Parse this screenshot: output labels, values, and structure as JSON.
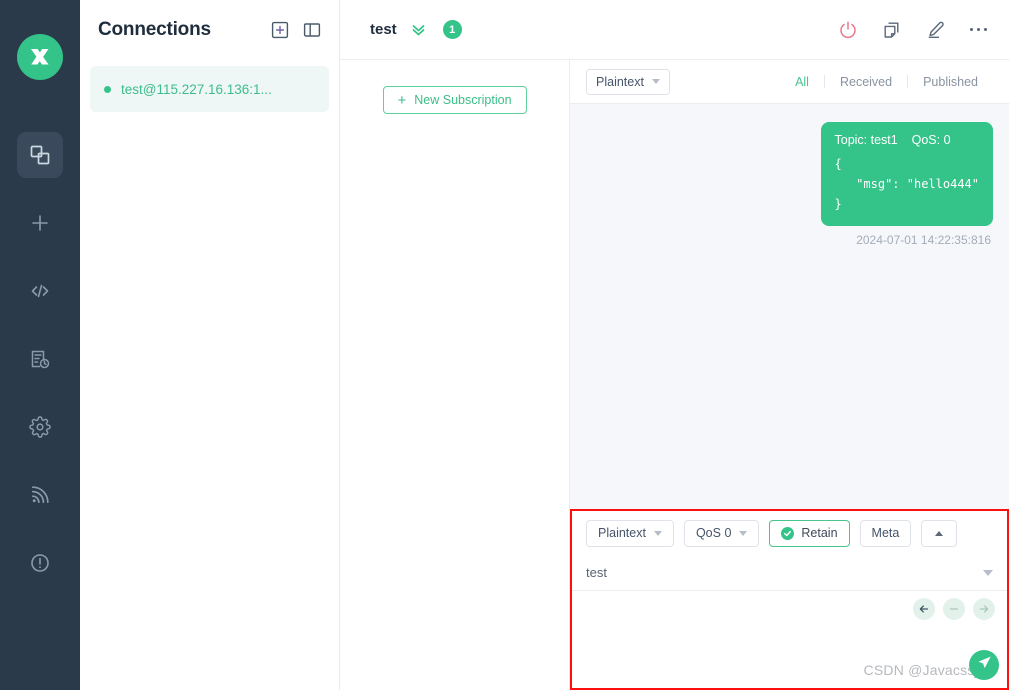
{
  "app": {
    "logo_icon": "mqttx-logo-icon",
    "accent_color": "#34c388",
    "rail_bg": "#2b3a4a",
    "highlight_border_color": "#fb0f0f"
  },
  "rail": {
    "items": [
      {
        "icon": "connections-icon",
        "name": "sidebar-item-connections",
        "active": true
      },
      {
        "icon": "plus-icon",
        "name": "sidebar-item-new-connection",
        "active": false
      },
      {
        "icon": "code-icon",
        "name": "sidebar-item-scripts",
        "active": false
      },
      {
        "icon": "log-history-icon",
        "name": "sidebar-item-log",
        "active": false
      },
      {
        "icon": "gear-icon",
        "name": "sidebar-item-settings",
        "active": false
      },
      {
        "icon": "broadcast-icon",
        "name": "sidebar-item-broadcast",
        "active": false
      },
      {
        "icon": "info-circle-icon",
        "name": "sidebar-item-about",
        "active": false
      }
    ]
  },
  "connections": {
    "title": "Connections",
    "new_icon": "plus-square-icon",
    "layout_icon": "panel-layout-icon",
    "items": [
      {
        "label": "test@115.227.16.136:1...",
        "status": "connected"
      }
    ]
  },
  "topbar": {
    "title": "test",
    "chevron_icon": "double-chevron-down-icon",
    "badge": "1",
    "actions": [
      {
        "name": "disconnect-button",
        "icon": "power-icon"
      },
      {
        "name": "copy-connection-button",
        "icon": "copy-icon"
      },
      {
        "name": "edit-connection-button",
        "icon": "pencil-icon"
      },
      {
        "name": "more-options-button",
        "icon": "ellipsis-icon"
      }
    ]
  },
  "subscriptions": {
    "new_subscription_label": "New Subscription",
    "plus_glyph": "+"
  },
  "messages": {
    "format_select": "Plaintext",
    "filters": [
      {
        "label": "All",
        "active": true
      },
      {
        "label": "Received",
        "active": false
      },
      {
        "label": "Published",
        "active": false
      }
    ],
    "list": [
      {
        "meta": "Topic: test1    QoS: 0",
        "body": "{\n   \"msg\": \"hello444\"\n}",
        "time": "2024-07-01 14:22:35:816",
        "direction": "published"
      }
    ]
  },
  "publish": {
    "format_select": "Plaintext",
    "qos_select": "QoS 0",
    "retain_label": "Retain",
    "retain_checked": true,
    "meta_label": "Meta",
    "collapse_icon": "chevron-up-icon",
    "topic_value": "test",
    "topic_caret_icon": "chevron-down-icon",
    "payload_value": "",
    "nav": [
      {
        "name": "history-prev-button",
        "icon": "arrow-left-icon",
        "enabled": true
      },
      {
        "name": "history-clear-button",
        "icon": "minus-icon",
        "enabled": false
      },
      {
        "name": "history-next-button",
        "icon": "arrow-right-icon",
        "enabled": false
      }
    ],
    "send_icon": "send-icon",
    "watermark": "CSDN @Javacssjsp"
  }
}
